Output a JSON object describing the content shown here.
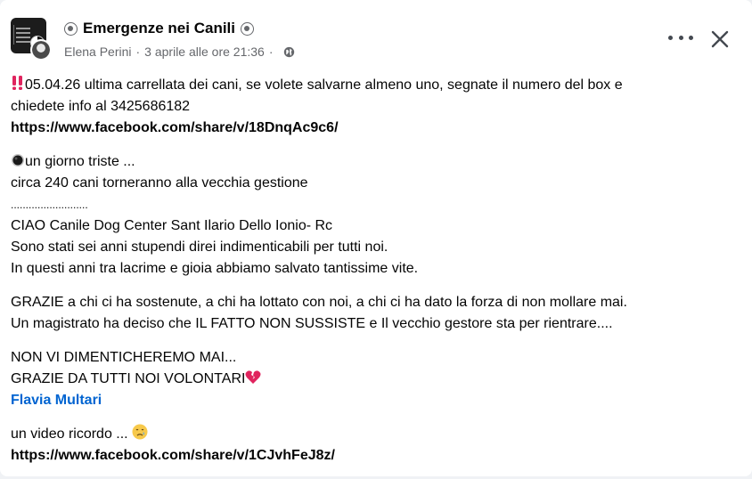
{
  "post": {
    "group_name": "Emergenze nei Canili",
    "author": "Elena Perini",
    "separator": "·",
    "timestamp": "3 aprile alle ore 21:36",
    "visibility_icon": "globe-icon",
    "more_icon": "more-options-icon",
    "close_icon": "close-icon"
  },
  "body": {
    "p1_line1": "05.04.26 ultima carrellata dei cani, se volete salvarne almeno uno, segnate il numero del box e",
    "p1_line2": "chiedete info al 3425686182",
    "p1_link": "https://www.facebook.com/share/v/18DnqAc9c6/",
    "p2_line1": "un giorno triste ...",
    "p2_line2": "circa 240 cani torneranno alla vecchia gestione",
    "p2_line3": "..........................",
    "p2_line4": "CIAO Canile Dog Center Sant Ilario Dello Ionio- Rc",
    "p2_line5": "Sono stati sei anni stupendi direi indimenticabili per tutti noi.",
    "p2_line6": "In questi anni tra lacrime e gioia abbiamo salvato tantissime vite.",
    "p3_line1": "GRAZIE a chi ci ha sostenute, a chi ha lottato con noi, a chi ci ha dato la forza di non mollare mai.",
    "p3_line2": "Un magistrato ha deciso che IL FATTO NON SUSSISTE e Il vecchio gestore sta per rientrare....",
    "p4_line1": "NON VI DIMENTICHEREMO MAI...",
    "p4_line2": "GRAZIE DA TUTTI NOI VOLONTARI",
    "p4_mention": "Flavia Multari",
    "p5_line1": "un video ricordo ...",
    "p5_link": "https://www.facebook.com/share/v/1CJvhFeJ8z/"
  },
  "colors": {
    "mention": "#0064d1",
    "meta": "#65676b",
    "alert": "#e0245e",
    "broken_heart": "#e0245e"
  }
}
